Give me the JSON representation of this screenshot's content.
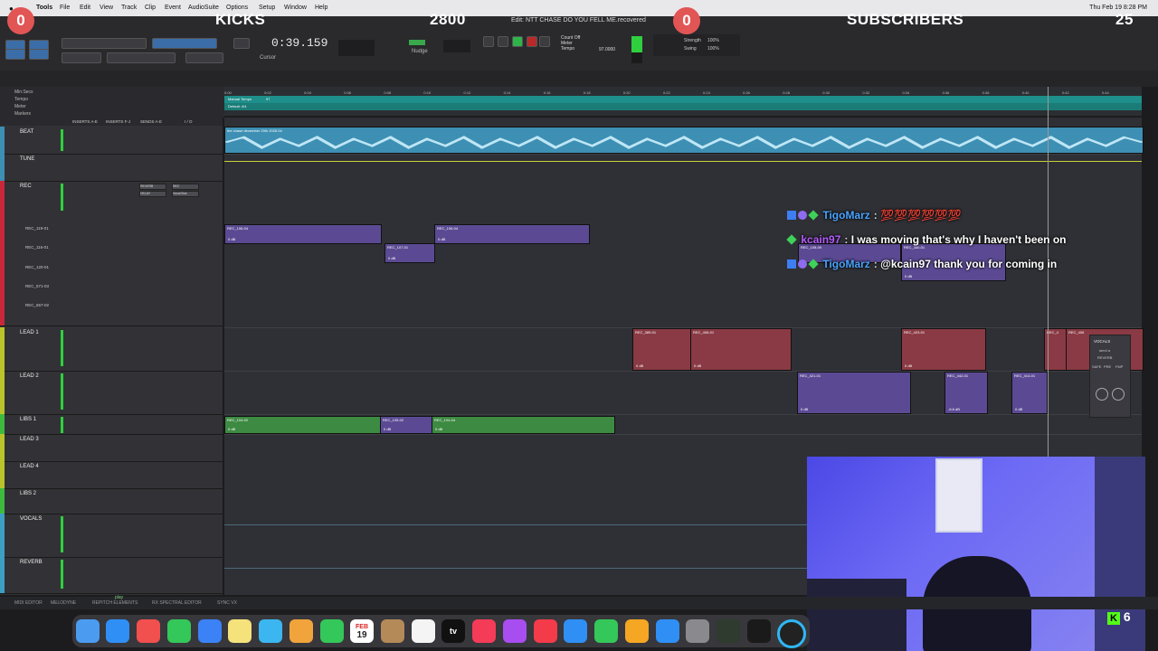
{
  "menubar": {
    "apple": "",
    "app_name": "Tools",
    "items": [
      "File",
      "Edit",
      "View",
      "Track",
      "Clip",
      "Event",
      "AudioSuite",
      "Options",
      "Setup",
      "Window",
      "Help"
    ],
    "clock": "Thu Feb 19  8:28 PM"
  },
  "overlay": {
    "kicks_count": "0",
    "kicks_label": "KICKS",
    "kicks_goal": "2800",
    "subs_count": "0",
    "subs_label": "SUBSCRIBERS",
    "subs_goal": "25"
  },
  "session": {
    "title": "Edit: NTT CHASE DO YOU FELL ME.recovered"
  },
  "toolbar": {
    "mode_shuffle": "SHUFFLE",
    "mode_spot": "SPOT",
    "mode_slip": "SLIP",
    "mode_grid": "GRID",
    "main_counter": "0:39.159",
    "cursor_label": "Cursor",
    "nudge_label": "Nudge",
    "count_off": "Count Off",
    "meter": "Meter",
    "tempo": "Tempo",
    "tempo_value": "97.0000",
    "grid_value": "1/16 note",
    "strength": "Strength",
    "strength_value": "100%",
    "swing": "Swing",
    "swing_value": "100%"
  },
  "rulers": {
    "min_secs": "Min:Secs",
    "tempo": "Tempo",
    "meter": "Meter",
    "markers": "Markers",
    "manual_tempo": "Manual Tempo",
    "manual_tempo_value": "97",
    "meter_default": "Default: 4/4",
    "ticks": [
      "0:00",
      "0:02",
      "0:04",
      "0:06",
      "0:08",
      "0:10",
      "0:12",
      "0:14",
      "0:16",
      "0:18",
      "0:20",
      "0:22",
      "0:24",
      "0:26",
      "0:28",
      "0:30",
      "0:32",
      "0:34",
      "0:36",
      "0:38",
      "0:40",
      "0:42",
      "0:44"
    ]
  },
  "track_header": {
    "inserts_ae": "INSERTS A-E",
    "inserts_fj": "INSERTS F-J",
    "sends_ae": "SENDS A-E",
    "io": "I / O"
  },
  "tracks": [
    {
      "name": "BEAT",
      "color": "#3d8fb3"
    },
    {
      "name": "TUNE",
      "color": "#3d8fb3"
    },
    {
      "name": "REC",
      "color": "#c8283a"
    },
    {
      "name": "LEAD 1",
      "color": "#b9c42a"
    },
    {
      "name": "LEAD 2",
      "color": "#b9c42a"
    },
    {
      "name": "LIBS 1",
      "color": "#3dbb3f"
    },
    {
      "name": "LEAD 3",
      "color": "#b9c42a"
    },
    {
      "name": "LEAD 4",
      "color": "#b9c42a"
    },
    {
      "name": "LIBS 2",
      "color": "#3dbb3f"
    },
    {
      "name": "VOCALS",
      "color": "#3d9fc4"
    },
    {
      "name": "REVERB",
      "color": "#3d9fc4"
    }
  ],
  "rec_playlists": [
    "REC_119-01",
    "REC_116-01",
    "REC_120-01",
    "REC_571-03",
    "REC_657-02"
  ],
  "inserts": {
    "reverb": "REVERB",
    "delay": "DELAY",
    "vocal_bus": "Vocal Bus",
    "rec": "REC",
    "vol": "vol",
    "pan": "pan"
  },
  "clips": {
    "beat": "the chase december 20th 2025.04",
    "rec_a": "REC_106-04",
    "rec_b": "REC_106-04",
    "rec_c": "REC_107-01",
    "rec_d": "REC_108-09",
    "rec_e": "REC_380-01",
    "lead1_a": "REC_389-01",
    "lead1_b": "REC_406-01",
    "lead1_c": "REC_423-01",
    "lead1_d": "REC_4",
    "lead1_e": "REC_406",
    "lead2_a": "REC_421-01",
    "lead2_b": "REC_442-01",
    "lead2_c": "REC_414-01",
    "libs_a": "REC_104-02",
    "libs_b": "REC_105-02",
    "libs_c": "REC_104-04",
    "gain": "0 dB",
    "gain_neg": "-6.6 dB"
  },
  "chat": [
    {
      "user": "TigoMarz",
      "user_color": "#4aa3ff",
      "sep": ":",
      "text": "💯💯💯💯💯💯",
      "text_color": "#e84b4b"
    },
    {
      "user": "kcain97",
      "user_color": "#b45cff",
      "sep": ":",
      "text": "I was moving that's why I haven't been on",
      "text_color": "#ffffff"
    },
    {
      "user": "TigoMarz",
      "user_color": "#4aa3ff",
      "sep": ":",
      "text": "@kcain97 thank you for coming in",
      "text_color": "#ffffff"
    }
  ],
  "mini_mixer": {
    "name": "VOCALS",
    "send": "send a",
    "reverb": "REVERB",
    "safe": "SAFE",
    "pre": "PRE",
    "fmp": "FMP"
  },
  "statusbar": {
    "items": [
      "MIDI EDITOR",
      "MELODYNE",
      "REPITCH ELEMENTS",
      "RX SPECTRAL EDITOR",
      "SYNC VX"
    ],
    "play": "play"
  },
  "dock": {
    "calendar_month": "FEB",
    "calendar_day": "19",
    "tv": "tv",
    "kick_count": "6"
  }
}
